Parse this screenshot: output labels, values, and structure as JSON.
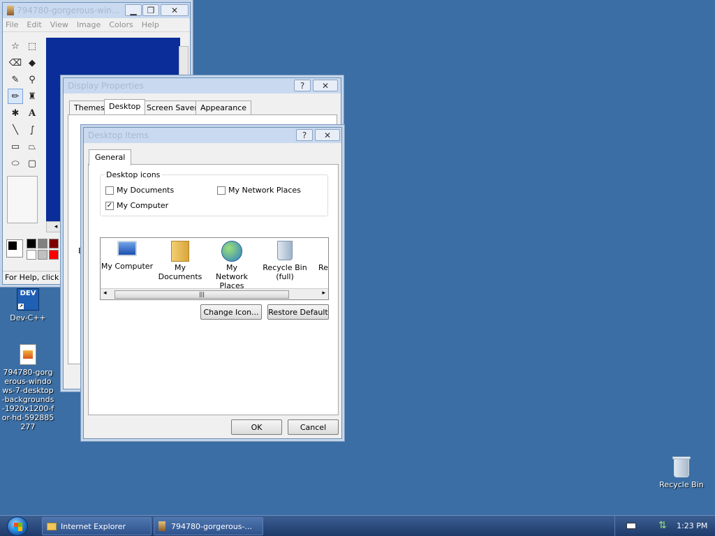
{
  "desktop": {
    "icons": [
      {
        "label": "Dev-C++"
      },
      {
        "label": "794780-gorgerous-windows-7-desktop-backgrounds-1920x1200-for-hd-592885277"
      },
      {
        "label": "Recycle Bin"
      }
    ],
    "devcpp_badge": "DEV"
  },
  "paint": {
    "title": "794780-gorgerous-win...",
    "menu": [
      "File",
      "Edit",
      "View",
      "Image",
      "Colors",
      "Help"
    ],
    "status": "For Help, click H"
  },
  "display_properties": {
    "title": "Display Properties",
    "tabs": [
      "Themes",
      "Desktop",
      "Screen Saver",
      "Appearance"
    ],
    "partial_letter": "B"
  },
  "desktop_items": {
    "title": "Desktop Items",
    "tab": "General",
    "group_label": "Desktop icons",
    "checkboxes": [
      {
        "label": "My Documents",
        "checked": false
      },
      {
        "label": "My Network Places",
        "checked": false
      },
      {
        "label": "My Computer",
        "checked": true
      }
    ],
    "list_items": [
      {
        "label": "My Computer"
      },
      {
        "label": "My Documents"
      },
      {
        "label": "My Network Places"
      },
      {
        "label": "Recycle Bin (full)"
      },
      {
        "label": "Rec"
      }
    ],
    "change_icon": "Change Icon...",
    "restore_default": "Restore Default",
    "ok": "OK",
    "cancel": "Cancel"
  },
  "taskbar": {
    "items": [
      "Internet Explorer",
      "794780-gorgerous-..."
    ],
    "clock": "1:23 PM"
  }
}
